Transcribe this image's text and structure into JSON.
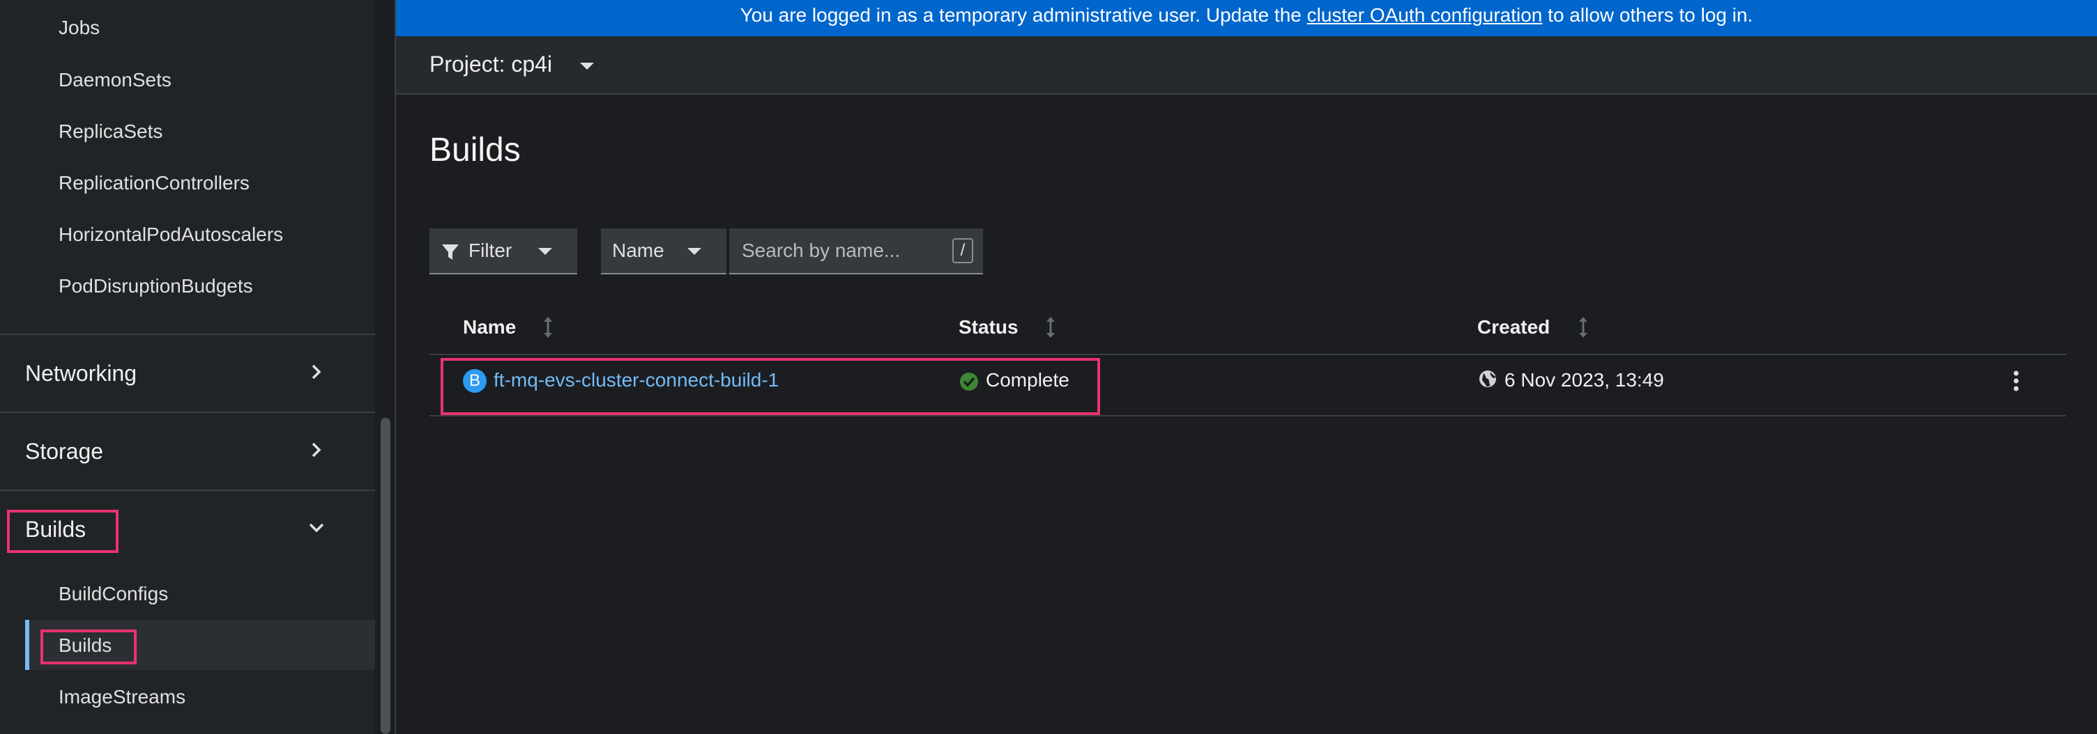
{
  "banner": {
    "prefix": "You are logged in as a temporary administrative user. Update the ",
    "link": "cluster OAuth configuration",
    "suffix": " to allow others to log in."
  },
  "project": {
    "label": "Project: cp4i"
  },
  "sidebar": {
    "workload_items": [
      "Jobs",
      "DaemonSets",
      "ReplicaSets",
      "ReplicationControllers",
      "HorizontalPodAutoscalers",
      "PodDisruptionBudgets"
    ],
    "sections": {
      "networking": "Networking",
      "storage": "Storage",
      "builds": "Builds"
    },
    "builds_items": [
      "BuildConfigs",
      "Builds",
      "ImageStreams"
    ],
    "active_item": "Builds"
  },
  "page": {
    "title": "Builds"
  },
  "toolbar": {
    "filter_label": "Filter",
    "name_select": "Name",
    "search_placeholder": "Search by name...",
    "search_shortcut": "/"
  },
  "table": {
    "headers": {
      "name": "Name",
      "status": "Status",
      "created": "Created"
    },
    "rows": [
      {
        "badge": "B",
        "name": "ft-mq-evs-cluster-connect-build-1",
        "status": "Complete",
        "created": "6 Nov 2023, 13:49"
      }
    ]
  },
  "colors": {
    "accent": "#73bcf7",
    "banner": "#0066cc",
    "highlight": "#e8336f",
    "success": "#3e8635"
  }
}
